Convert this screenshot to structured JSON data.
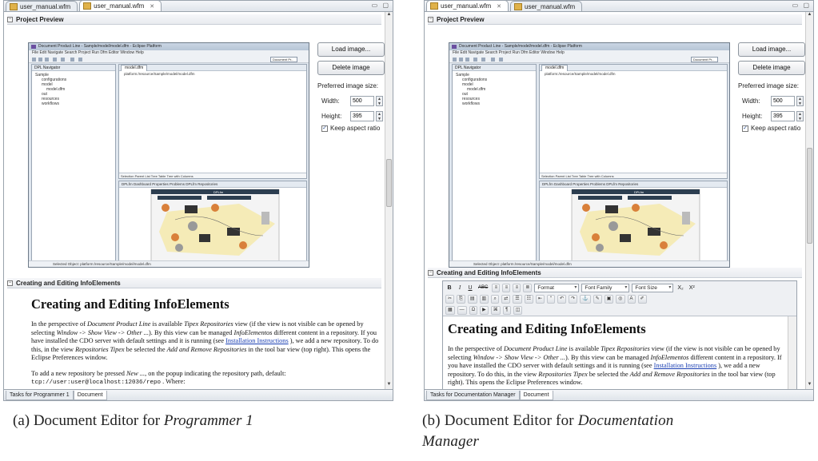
{
  "panel_a": {
    "tabs": [
      {
        "label": "user_manual.wfm",
        "active": false
      },
      {
        "label": "user_manual.wfm",
        "active": true
      }
    ],
    "project_preview": "Project Preview",
    "load_image": "Load image...",
    "delete_image": "Delete image",
    "preferred_size_label": "Preferred image size:",
    "width_label": "Width:",
    "width_value": "500",
    "height_label": "Height:",
    "height_value": "395",
    "keep_aspect": "Keep aspect ratio",
    "section2": "Creating and Editing InfoElements",
    "doc_title": "Creating and Editing InfoElements",
    "p1_a": "In the perspective of ",
    "p1_b": "Document Product Line",
    "p1_c": " is available ",
    "p1_d": "Tipex Repositories",
    "p1_e": " view (if the view is not visible can be opened by selecting ",
    "p1_f": "Window -> Show View -> Other ...",
    "p1_g": "). By this view can be managed ",
    "p1_h": "InfoElementos",
    "p1_i": " different content in a repository. If you have installed the CDO server with default settings and it is running (see ",
    "p1_link": "Installation Instructions",
    "p1_j": " ), we add a new repository. To do this, in the view ",
    "p1_k": "Repositories Tipex",
    "p1_l": " be selected the ",
    "p1_m": "Add and Remove Repositories",
    "p1_n": " in the tool bar view (top right). This opens the Eclipse Preferences window.",
    "p2_a": "To add a new repository be pressed ",
    "p2_b": "New ...",
    "p2_c": ", on the popup indicating the repository path, default:",
    "p2_code": "tcp://user:user@localhost:12036/repo",
    "p2_end": " . Where:",
    "bottom_tabs": [
      "Tasks for Programmer 1",
      "Document"
    ]
  },
  "panel_b": {
    "tabs": [
      {
        "label": "user_manual.wfm",
        "active": true
      },
      {
        "label": "user_manual.wfm",
        "active": false
      }
    ],
    "project_preview": "Project Preview",
    "load_image": "Load image...",
    "delete_image": "Delete image",
    "preferred_size_label": "Preferred image size:",
    "width_label": "Width:",
    "width_value": "500",
    "height_label": "Height:",
    "height_value": "395",
    "keep_aspect": "Keep aspect ratio",
    "section2": "Creating and Editing InfoElements",
    "toolbar": {
      "format": "Format",
      "font_family": "Font Family",
      "font_size": "Font Size",
      "bold": "B",
      "italic": "I",
      "underline": "U",
      "strike": "ABC",
      "subscript": "X₂",
      "superscript": "X²"
    },
    "doc_title": "Creating and Editing InfoElements",
    "p1_a": "In the perspective of ",
    "p1_b": "Document Product Line",
    "p1_c": " is available ",
    "p1_d": "Tipex Repositories",
    "p1_e": " view (if the view is not visible can be opened by selecting ",
    "p1_f": "Window -> Show View -> Other ...",
    "p1_g": "). By this view can be managed ",
    "p1_h": "InfoElementos",
    "p1_i": " different content in a repository. If you have installed the CDO server with default settings and it is running (see ",
    "p1_link": "Installation Instructions",
    "p1_j": " ), we add a new repository. To do this, in the view ",
    "p1_k": "Repositories Tipex",
    "p1_l": " be selected the ",
    "p1_m": "Add and Remove Repositories",
    "p1_n": " in the tool bar view (top right). This opens the Eclipse Preferences window.",
    "bottom_tabs": [
      "Tasks for Documentation Manager",
      "Document"
    ]
  },
  "preview": {
    "window_title": "Document Product Line - Sample/model/model.dfm - Eclipse Platform",
    "menu": "File  Edit  Navigate  Search  Project  Run  Dfm Editor  Window  Help",
    "perspective": "Document Pr...",
    "nav_title": "DPL Navigator",
    "tree": [
      "Sample",
      "configurations",
      "model",
      "model.dfm",
      "out",
      "resources",
      "workflows"
    ],
    "editor_tab": "model.dfm",
    "resource": "platform:/resource/Sample/model/model.dfm",
    "editor_tabs": "Selection  Parent  List  Tree  Table  Tree with Columns",
    "dash_tabs": "DPLfm Dashboard  Properties  Problems  DPLfm Repositories",
    "dash_title": "DPLfm",
    "status": "Selected Object: platform:/resource/Sample/model/model.dfm"
  },
  "captions": {
    "a_prefix": "(a) Document Editor for ",
    "a_role": "Programmer 1",
    "b_prefix": "(b) Document Editor for ",
    "b_role": "Documentation",
    "b_role2": "Manager"
  }
}
